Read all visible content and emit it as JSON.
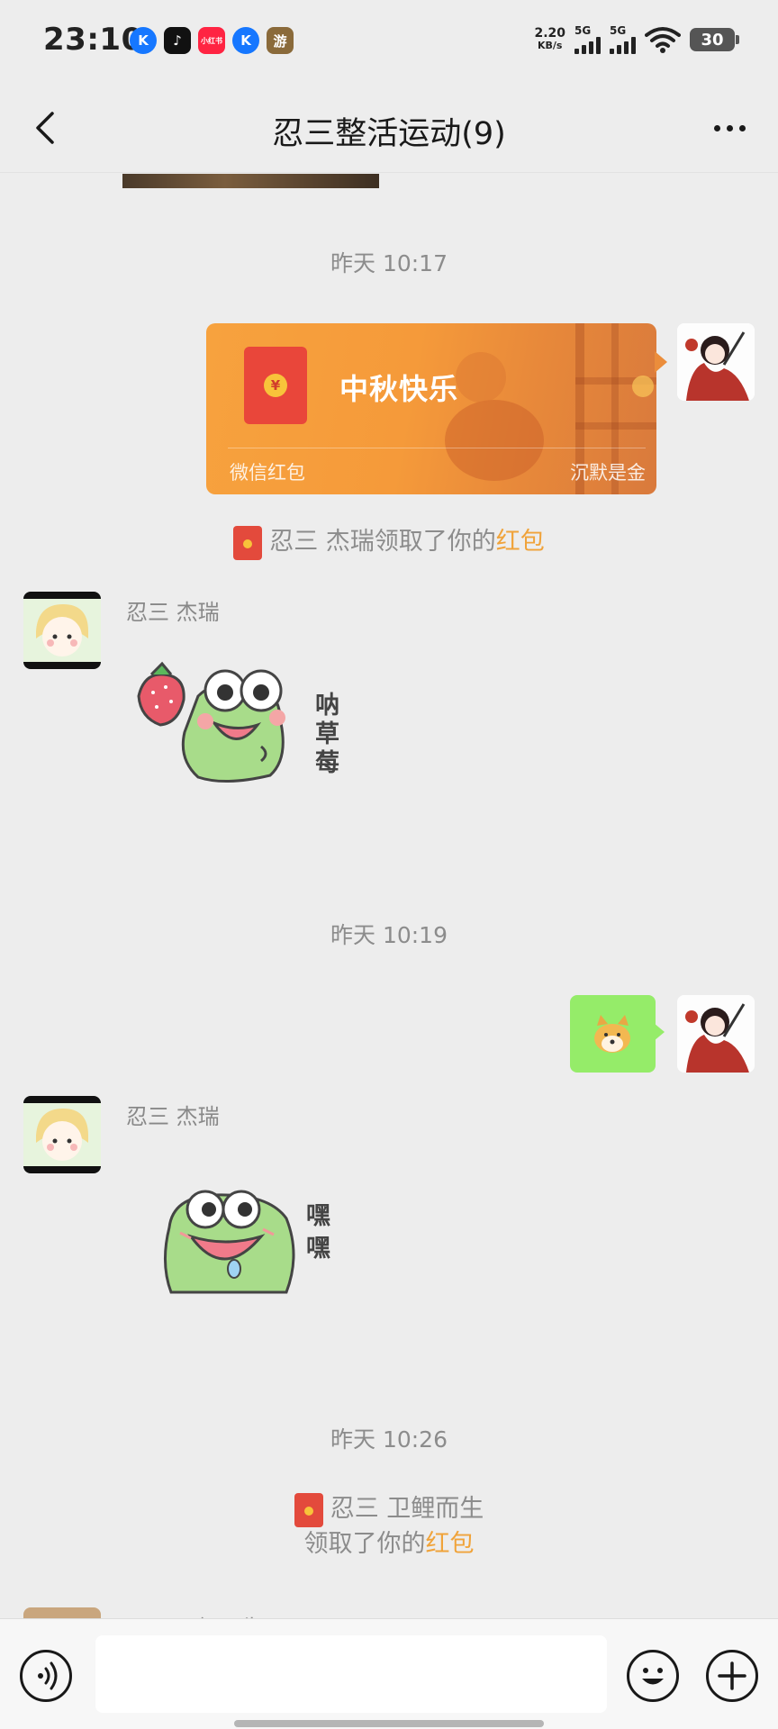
{
  "status_bar": {
    "time": "23:10",
    "apps": [
      "K",
      "♪",
      "小红书",
      "K",
      "游"
    ],
    "net_speed_value": "2.20",
    "net_speed_unit": "KB/s",
    "signal1_label": "5G",
    "signal2_label": "5G",
    "battery": "30"
  },
  "header": {
    "title": "忍三整活运动(9)"
  },
  "messages": {
    "time1": "昨天 10:17",
    "red_packet": {
      "greeting": "中秋快乐",
      "source": "微信红包",
      "sender_name": "沉默是金",
      "coin_symbol": "¥"
    },
    "claim1_prefix": "忍三 杰瑞领取了你的",
    "claim1_link": "红包",
    "sender1": "忍三 杰瑞",
    "sticker1_text": "呐草莓",
    "time2": "昨天 10:19",
    "sender2": "忍三 杰瑞",
    "sticker2_text": "嘿嘿",
    "time3": "昨天 10:26",
    "claim2_line1": "忍三 卫鲤而生",
    "claim2_prefix": "领取了你的",
    "claim2_link": "红包",
    "sender3": "忍三 卫鲤而生"
  },
  "colors": {
    "background": "#ededed",
    "red_packet": "#f7a23e",
    "link": "#f0a33a",
    "my_bubble": "#95ec69"
  }
}
